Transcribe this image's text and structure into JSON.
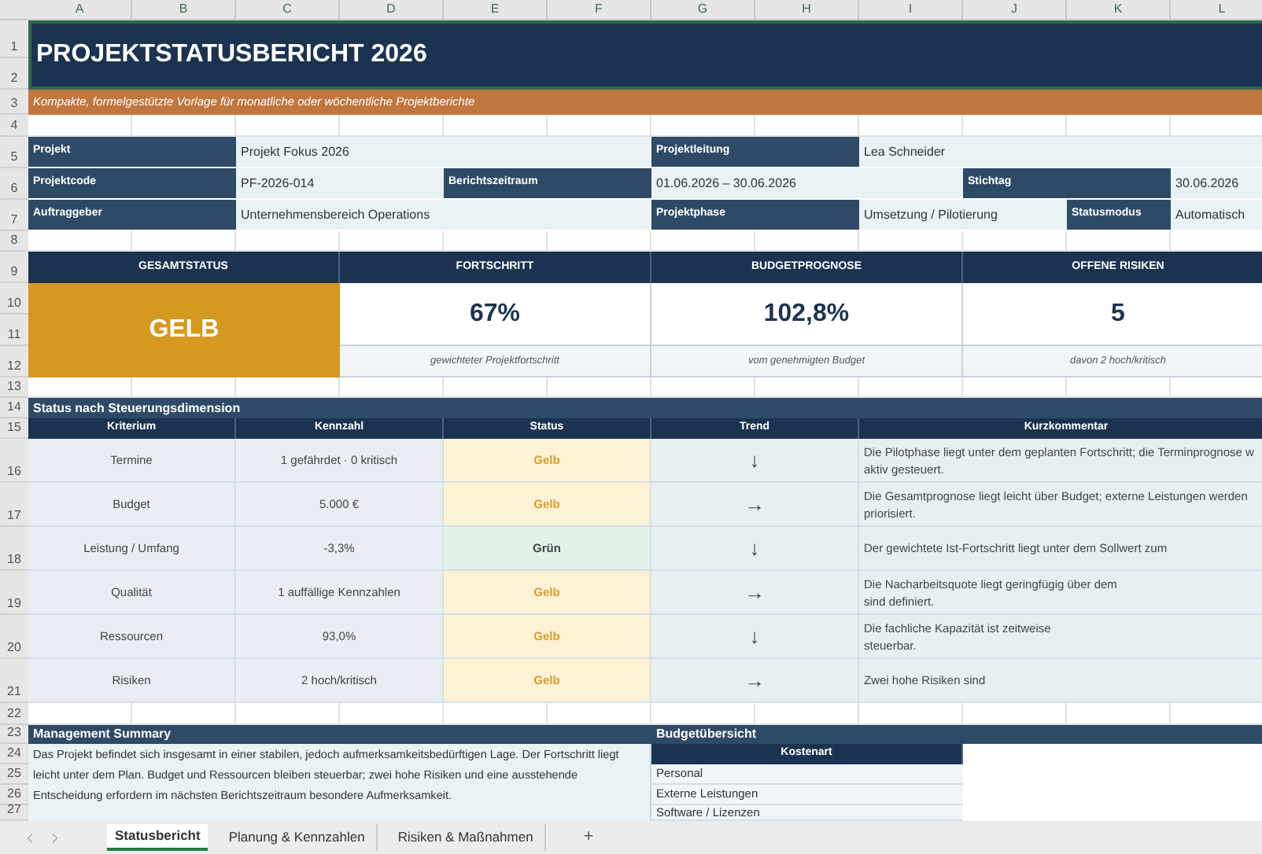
{
  "column_headers": [
    "A",
    "B",
    "C",
    "D",
    "E",
    "F",
    "G",
    "H",
    "I",
    "J",
    "K",
    "L"
  ],
  "row_numbers": [
    "1",
    "2",
    "3",
    "4",
    "5",
    "6",
    "7",
    "8",
    "9",
    "10",
    "11",
    "12",
    "13",
    "14",
    "15",
    "16",
    "17",
    "18",
    "19",
    "20",
    "21",
    "22",
    "23",
    "24",
    "25",
    "26",
    "27"
  ],
  "title": "PROJEKTSTATUSBERICHT 2026",
  "subtitle": "Kompakte, formelgestützte Vorlage für monatliche oder wöchentliche Projektberichte",
  "fields": [
    {
      "label": "Projekt",
      "value": "Projekt Fokus 2026"
    },
    {
      "label": "Projektleitung",
      "value": "Lea Schneider"
    },
    {
      "label": "Projektcode",
      "value": "PF-2026-014"
    },
    {
      "label": "Berichtszeitraum",
      "value": "01.06.2026 – 30.06.2026"
    },
    {
      "label": "Stichtag",
      "value": "30.06.2026"
    },
    {
      "label": "Auftraggeber",
      "value": "Unternehmensbereich Operations"
    },
    {
      "label": "Projektphase",
      "value": "Umsetzung / Pilotierung"
    },
    {
      "label": "Statusmodus",
      "value": "Automatisch"
    }
  ],
  "overall_status": {
    "label": "GESAMTSTATUS",
    "value": "GELB",
    "kind": "warning"
  },
  "kpis": [
    {
      "label": "FORTSCHRITT",
      "value": "67%",
      "caption": "gewichteter Projektfortschritt"
    },
    {
      "label": "BUDGETPROGNOSE",
      "value": "102,8%",
      "caption": "vom genehmigten Budget"
    },
    {
      "label": "OFFENE RISIKEN",
      "value": "5",
      "caption": "davon 2 hoch/kritisch"
    }
  ],
  "dimensions": {
    "title": "Status nach Steuerungsdimension",
    "columns": [
      "Kriterium",
      "Kennzahl",
      "Status",
      "Trend",
      "Kurzkommentar"
    ],
    "rows": [
      {
        "criterion": "Termine",
        "metric": "1 gefährdet · 0 kritisch",
        "status": "Gelb",
        "kind": "warning",
        "trend": "↓",
        "comment": [
          "Die Pilotphase liegt unter dem geplanten Fortschritt; die Terminprognose w",
          "aktiv gesteuert."
        ]
      },
      {
        "criterion": "Budget",
        "metric": "5.000 €",
        "status": "Gelb",
        "kind": "warning",
        "trend": "→",
        "comment": [
          "Die Gesamtprognose liegt leicht über Budget; externe Leistungen werden",
          "priorisiert."
        ]
      },
      {
        "criterion": "Leistung / Umfang",
        "metric": "-3,3%",
        "status": "Grün",
        "kind": "ok",
        "trend": "↓",
        "comment": [
          "Der gewichtete Ist-Fortschritt liegt unter dem Sollwert zum"
        ]
      },
      {
        "criterion": "Qualität",
        "metric": "1 auffällige Kennzahlen",
        "status": "Gelb",
        "kind": "warning",
        "trend": "→",
        "comment": [
          "Die Nacharbeitsquote liegt geringfügig über dem",
          "sind definiert."
        ]
      },
      {
        "criterion": "Ressourcen",
        "metric": "93,0%",
        "status": "Gelb",
        "kind": "warning",
        "trend": "↓",
        "comment": [
          "Die fachliche Kapazität ist zeitweise",
          "steuerbar."
        ]
      },
      {
        "criterion": "Risiken",
        "metric": "2 hoch/kritisch",
        "status": "Gelb",
        "kind": "warning",
        "trend": "→",
        "comment": [
          "Zwei hohe Risiken sind"
        ]
      }
    ]
  },
  "summary": {
    "title": "Management Summary",
    "text": "Das Projekt befindet sich insgesamt in einer stabilen, jedoch aufmerksamkeitsbedürftigen Lage. Der Fortschritt liegt leicht unter dem Plan. Budget und Ressourcen bleiben steuerbar; zwei hohe Risiken und eine ausstehende Entscheidung erfordern im nächsten Berichtszeitraum besondere Aufmerksamkeit."
  },
  "budget": {
    "title": "Budgetübersicht",
    "column": "Kostenart",
    "rows": [
      "Personal",
      "Externe Leistungen",
      "Software / Lizenzen"
    ]
  },
  "sheet_tabs": [
    {
      "label": "Statusbericht",
      "selected": true
    },
    {
      "label": "Planung & Kennzahlen",
      "selected": false
    },
    {
      "label": "Risiken & Maßnahmen",
      "selected": false
    }
  ],
  "add_sheet": "+"
}
